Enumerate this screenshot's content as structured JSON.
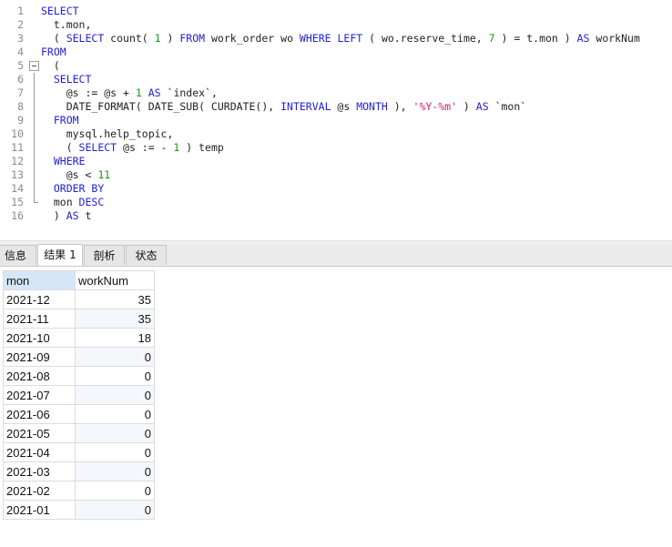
{
  "editor": {
    "lines": [
      {
        "n": "1",
        "fold": "",
        "segs": [
          {
            "t": "SELECT",
            "c": "kw"
          }
        ]
      },
      {
        "n": "2",
        "fold": "",
        "segs": [
          {
            "t": "  t.mon,",
            "c": ""
          }
        ]
      },
      {
        "n": "3",
        "fold": "",
        "segs": [
          {
            "t": "  ( ",
            "c": ""
          },
          {
            "t": "SELECT",
            "c": "kw"
          },
          {
            "t": " count( ",
            "c": ""
          },
          {
            "t": "1",
            "c": "num"
          },
          {
            "t": " ) ",
            "c": ""
          },
          {
            "t": "FROM",
            "c": "kw"
          },
          {
            "t": " work_order wo ",
            "c": ""
          },
          {
            "t": "WHERE",
            "c": "kw"
          },
          {
            "t": " ",
            "c": ""
          },
          {
            "t": "LEFT",
            "c": "kw"
          },
          {
            "t": " ( wo.reserve_time, ",
            "c": ""
          },
          {
            "t": "7",
            "c": "num"
          },
          {
            "t": " ) = t.mon ) ",
            "c": ""
          },
          {
            "t": "AS",
            "c": "kw"
          },
          {
            "t": " workNum",
            "c": ""
          }
        ]
      },
      {
        "n": "4",
        "fold": "",
        "segs": [
          {
            "t": "FROM",
            "c": "kw"
          }
        ]
      },
      {
        "n": "5",
        "fold": "box",
        "segs": [
          {
            "t": "  (",
            "c": ""
          }
        ]
      },
      {
        "n": "6",
        "fold": "line",
        "segs": [
          {
            "t": "  ",
            "c": ""
          },
          {
            "t": "SELECT",
            "c": "kw"
          }
        ]
      },
      {
        "n": "7",
        "fold": "line",
        "segs": [
          {
            "t": "    @s := @s + ",
            "c": ""
          },
          {
            "t": "1",
            "c": "num"
          },
          {
            "t": " ",
            "c": ""
          },
          {
            "t": "AS",
            "c": "kw"
          },
          {
            "t": " `index`,",
            "c": ""
          }
        ]
      },
      {
        "n": "8",
        "fold": "line",
        "segs": [
          {
            "t": "    DATE_FORMAT( DATE_SUB( CURDATE(), ",
            "c": ""
          },
          {
            "t": "INTERVAL",
            "c": "kw"
          },
          {
            "t": " @s ",
            "c": ""
          },
          {
            "t": "MONTH",
            "c": "kw"
          },
          {
            "t": " ), ",
            "c": ""
          },
          {
            "t": "'%Y-%m'",
            "c": "str"
          },
          {
            "t": " ) ",
            "c": ""
          },
          {
            "t": "AS",
            "c": "kw"
          },
          {
            "t": " `mon`",
            "c": ""
          }
        ]
      },
      {
        "n": "9",
        "fold": "line",
        "segs": [
          {
            "t": "  ",
            "c": ""
          },
          {
            "t": "FROM",
            "c": "kw"
          }
        ]
      },
      {
        "n": "10",
        "fold": "line",
        "segs": [
          {
            "t": "    mysql.help_topic,",
            "c": ""
          }
        ]
      },
      {
        "n": "11",
        "fold": "line",
        "segs": [
          {
            "t": "    ( ",
            "c": ""
          },
          {
            "t": "SELECT",
            "c": "kw"
          },
          {
            "t": " @s := - ",
            "c": ""
          },
          {
            "t": "1",
            "c": "num"
          },
          {
            "t": " ) temp",
            "c": ""
          }
        ]
      },
      {
        "n": "12",
        "fold": "line",
        "segs": [
          {
            "t": "  ",
            "c": ""
          },
          {
            "t": "WHERE",
            "c": "kw"
          }
        ]
      },
      {
        "n": "13",
        "fold": "line",
        "segs": [
          {
            "t": "    @s < ",
            "c": ""
          },
          {
            "t": "11",
            "c": "num"
          }
        ]
      },
      {
        "n": "14",
        "fold": "line",
        "segs": [
          {
            "t": "  ",
            "c": ""
          },
          {
            "t": "ORDER BY",
            "c": "kw"
          }
        ]
      },
      {
        "n": "15",
        "fold": "end",
        "segs": [
          {
            "t": "  mon ",
            "c": ""
          },
          {
            "t": "DESC",
            "c": "kw"
          }
        ]
      },
      {
        "n": "16",
        "fold": "",
        "segs": [
          {
            "t": "  ) ",
            "c": ""
          },
          {
            "t": "AS",
            "c": "kw"
          },
          {
            "t": " t",
            "c": ""
          }
        ]
      }
    ]
  },
  "tabs": [
    {
      "label": "信息",
      "active": false
    },
    {
      "label": "结果 1",
      "active": true
    },
    {
      "label": "剖析",
      "active": false
    },
    {
      "label": "状态",
      "active": false
    }
  ],
  "result": {
    "columns": [
      "mon",
      "workNum"
    ],
    "rows": [
      [
        "2021-12",
        "35"
      ],
      [
        "2021-11",
        "35"
      ],
      [
        "2021-10",
        "18"
      ],
      [
        "2021-09",
        "0"
      ],
      [
        "2021-08",
        "0"
      ],
      [
        "2021-07",
        "0"
      ],
      [
        "2021-06",
        "0"
      ],
      [
        "2021-05",
        "0"
      ],
      [
        "2021-04",
        "0"
      ],
      [
        "2021-03",
        "0"
      ],
      [
        "2021-02",
        "0"
      ],
      [
        "2021-01",
        "0"
      ]
    ]
  }
}
